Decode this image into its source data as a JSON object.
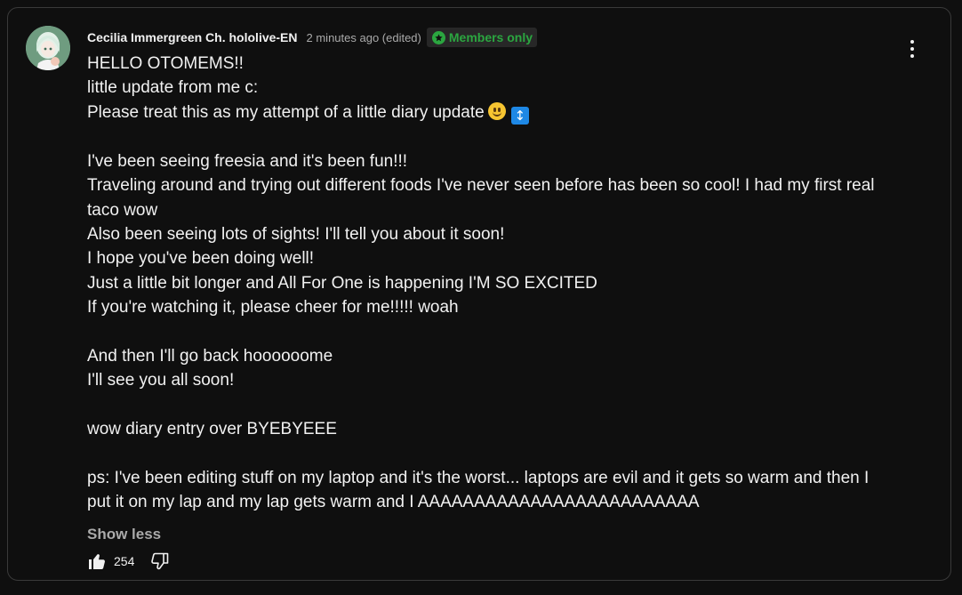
{
  "comment": {
    "author": "Cecilia Immergreen Ch. hololive-EN",
    "timestamp": "2 minutes ago (edited)",
    "badge": {
      "label": "Members only",
      "icon": "members-star-icon",
      "color": "#2ba640"
    },
    "avatar_icon": "channel-avatar",
    "lines": [
      "HELLO OTOMEMS!!",
      "little update from me c:",
      "Please treat this as my attempt of a little diary update",
      "",
      "I've been seeing freesia and it's been fun!!!",
      "Traveling around and trying out different foods I've never seen before has been so cool! I had my first real taco wow",
      "Also been seeing lots of sights! I'll tell you about it soon!",
      "I hope you've been doing well!",
      "Just a little bit longer and All For One is happening I'M SO EXCITED",
      "If you're watching it, please cheer for me!!!!! woah",
      "",
      "And then I'll go back hoooooome",
      "I'll see you all soon!",
      "",
      "wow diary entry over BYEBYEEE",
      "",
      "ps: I've been editing stuff on my laptop and it's the worst... laptops are evil and it gets so warm and then I put it on my lap and my lap gets warm and I AAAAAAAAAAAAAAAAAAAAAAAAA"
    ],
    "emojis": [
      "slightly-smiling-face-emoji",
      "up-down-arrow-emoji"
    ],
    "show_less_label": "Show less",
    "like_count": "254",
    "menu_icon": "more-vertical-icon"
  },
  "colors": {
    "background": "#0f0f0f",
    "text": "#f1f1f1",
    "secondary_text": "#aaaaaa",
    "border": "#3a3a3a"
  }
}
